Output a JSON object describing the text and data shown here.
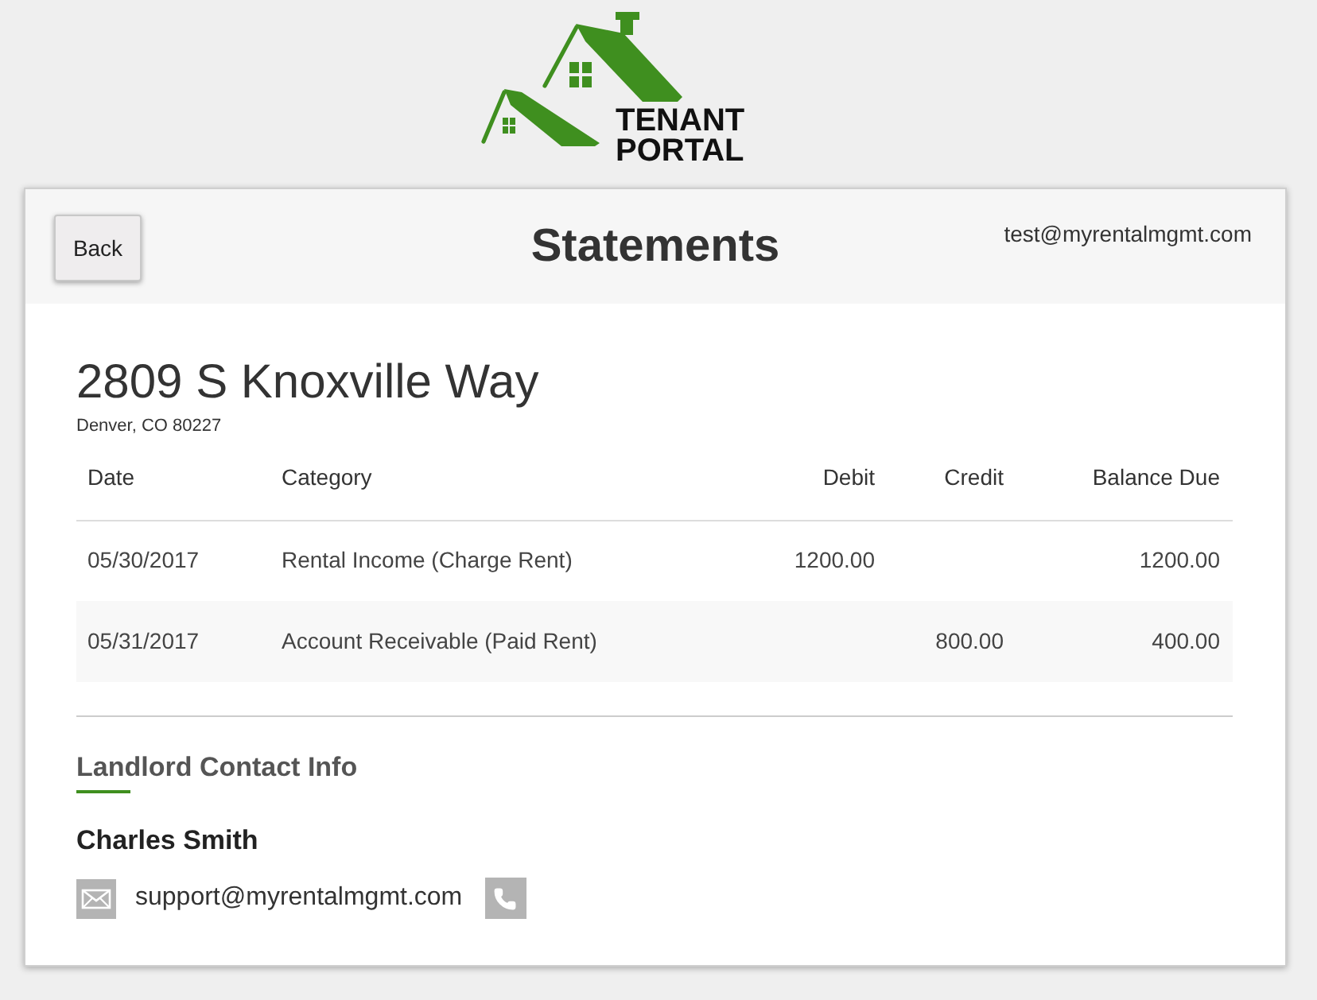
{
  "logo": {
    "line_1": "TENANT",
    "line_2": "PORTAL"
  },
  "header": {
    "back_button": "Back",
    "title": "Statements",
    "user_email": "test@myrentalmgmt.com"
  },
  "property": {
    "address": "2809 S Knoxville Way",
    "city_line": "Denver, CO 80227"
  },
  "table": {
    "columns": [
      "Date",
      "Category",
      "Debit",
      "Credit",
      "Balance Due"
    ],
    "rows": [
      {
        "date": "05/30/2017",
        "category": "Rental Income (Charge Rent)",
        "debit": "1200.00",
        "balance_due": "1200.00"
      },
      {
        "date": "05/31/2017",
        "category": "Account Receivable (Paid Rent)",
        "credit": "800.00",
        "balance_due": "400.00"
      }
    ]
  },
  "contact": {
    "heading": "Landlord Contact Info",
    "name": "Charles Smith",
    "email": "support@myrentalmgmt.com"
  }
}
